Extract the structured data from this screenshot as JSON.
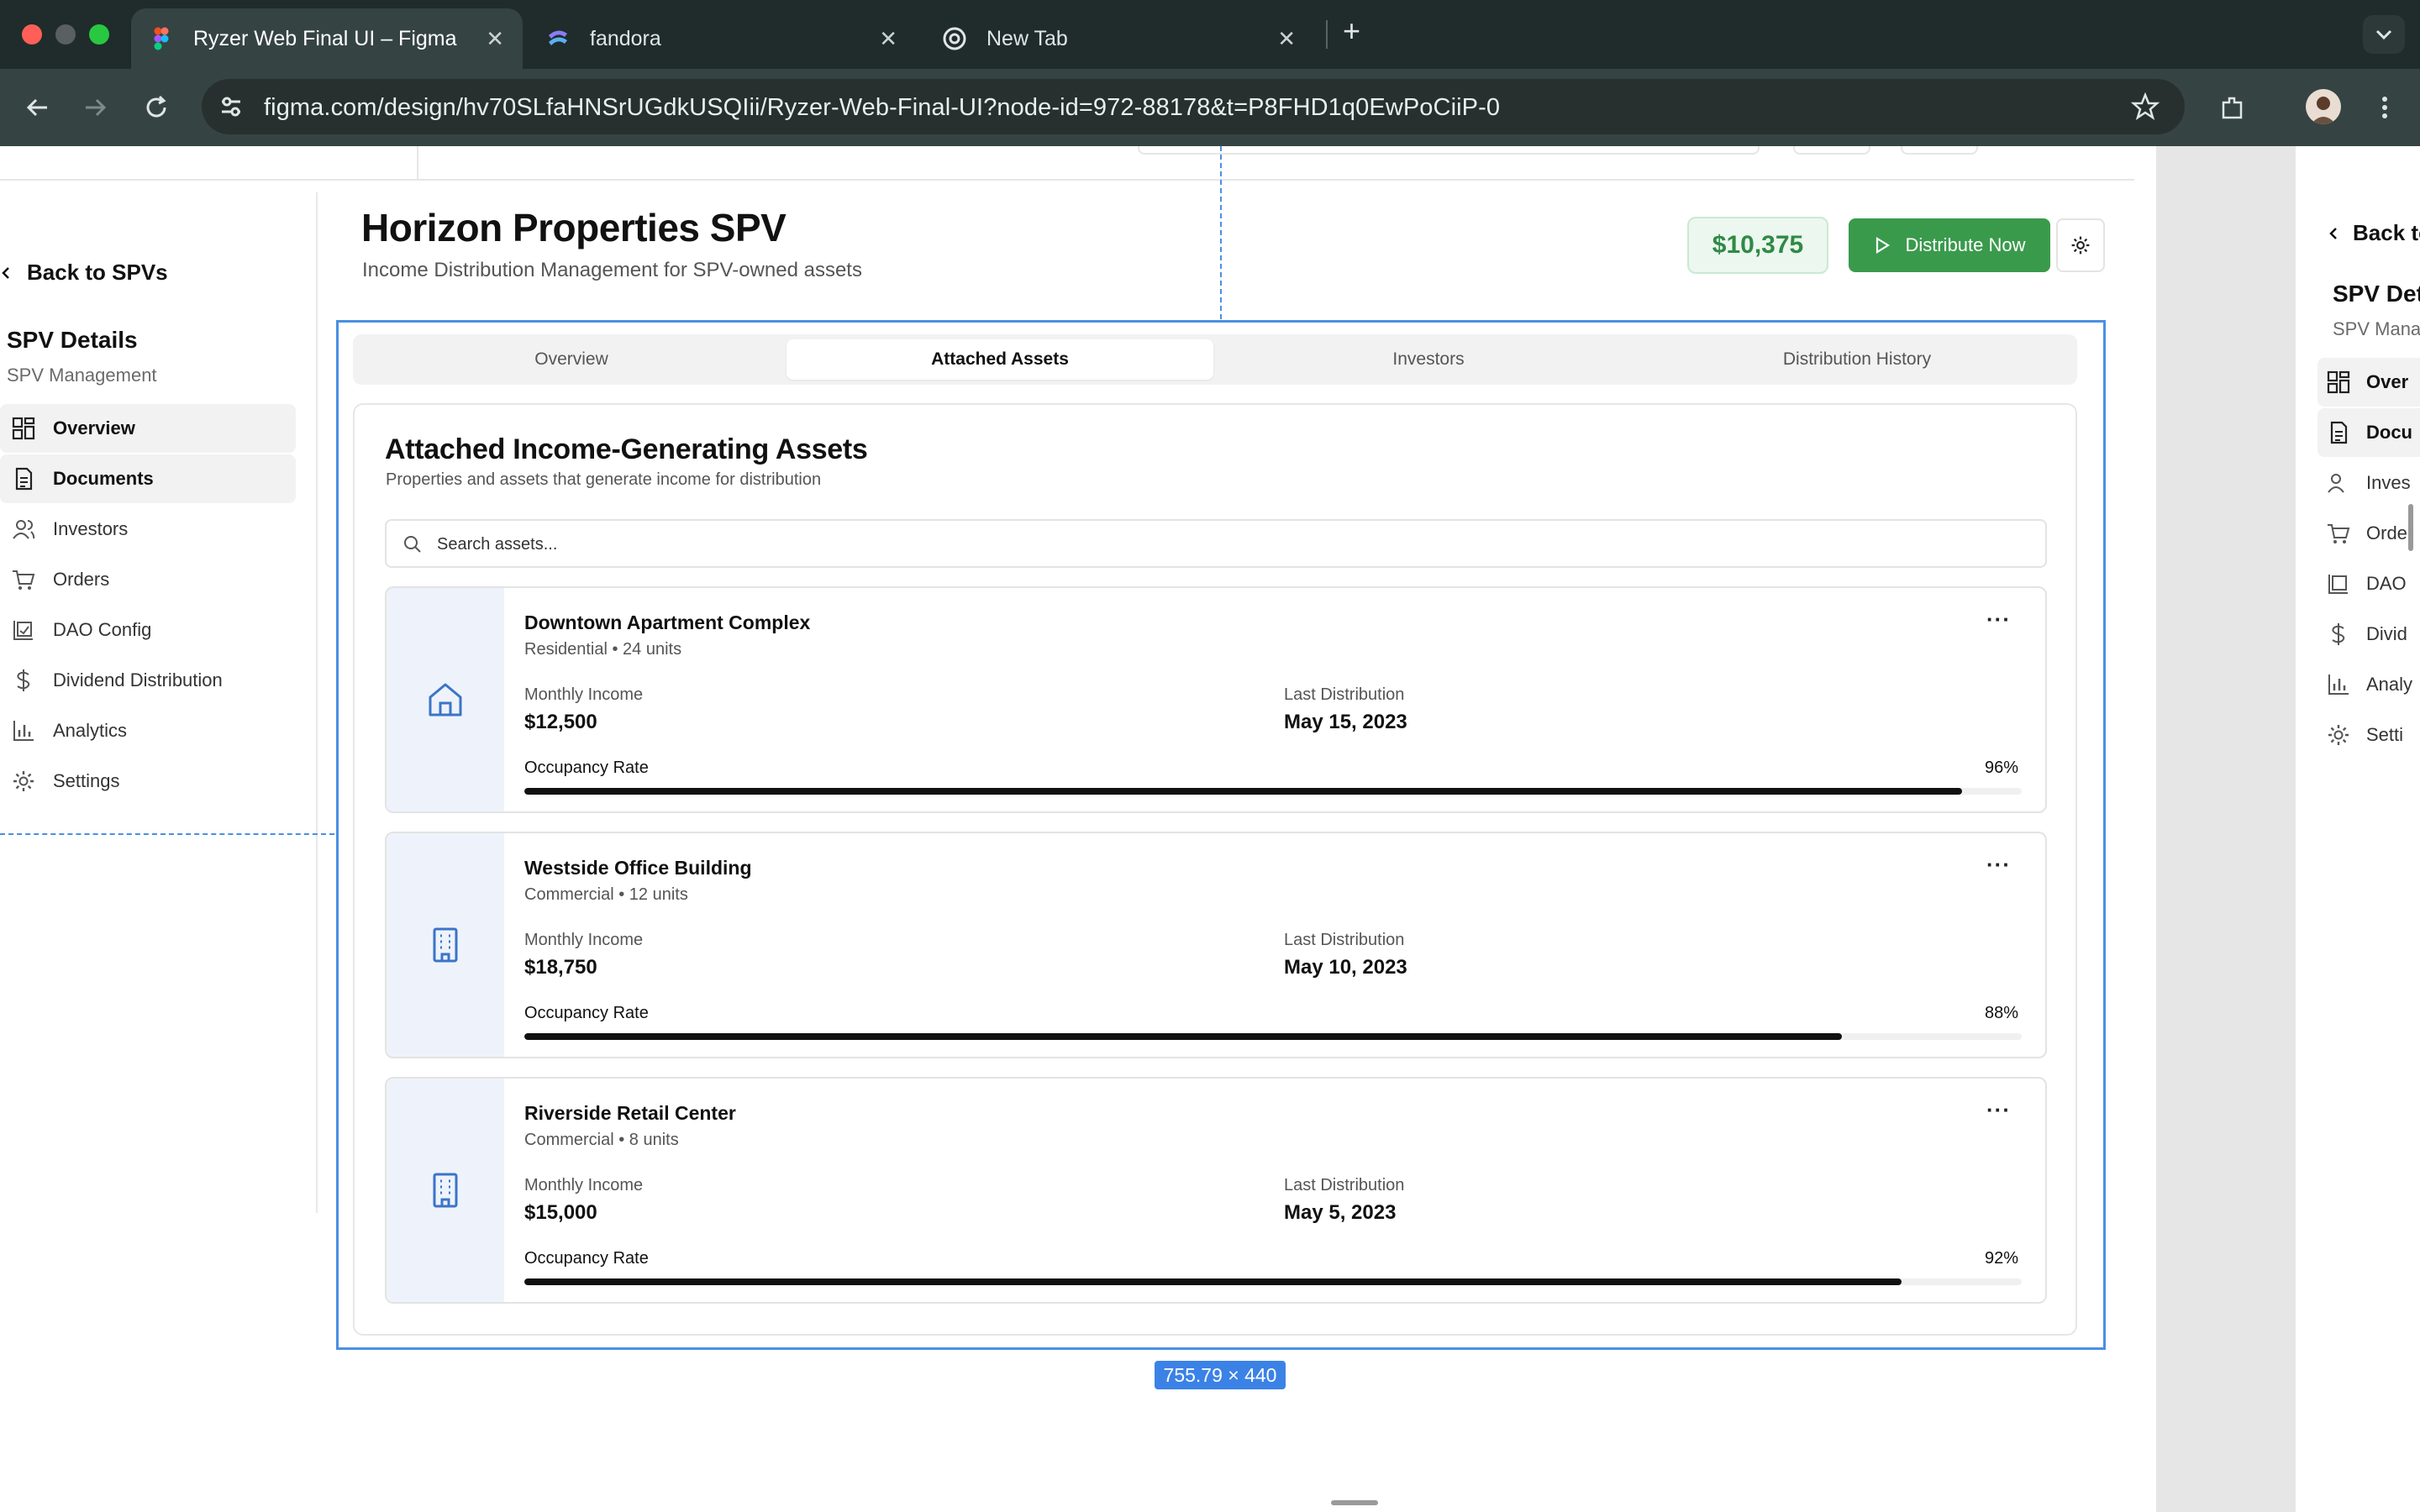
{
  "browser": {
    "tabs": [
      {
        "label": "Ryzer Web Final UI – Figma",
        "icon": "figma-icon",
        "active": true
      },
      {
        "label": "fandora",
        "icon": "fandora-icon",
        "active": false
      },
      {
        "label": "New Tab",
        "icon": "chrome-icon",
        "active": false
      }
    ],
    "close_glyph": "✕",
    "new_tab_glyph": "+",
    "url": "figma.com/design/hv70SLfaHNSrUGdkUSQIii/Ryzer-Web-Final-UI?node-id=972-88178&t=P8FHD1q0EwPoCiiP-0"
  },
  "sidebar": {
    "back_label": "Back to SPVs",
    "title": "SPV Details",
    "subtitle": "SPV Management",
    "items": [
      {
        "label": "Overview",
        "icon": "grid-icon",
        "active": false
      },
      {
        "label": "Documents",
        "icon": "document-icon",
        "active": true
      },
      {
        "label": "Investors",
        "icon": "users-icon",
        "active": false
      },
      {
        "label": "Orders",
        "icon": "cart-icon",
        "active": false
      },
      {
        "label": "DAO Config",
        "icon": "chart-check-icon",
        "active": false
      },
      {
        "label": "Dividend Distribution",
        "icon": "dollar-icon",
        "active": false
      },
      {
        "label": "Analytics",
        "icon": "bar-chart-icon",
        "active": false
      },
      {
        "label": "Settings",
        "icon": "gear-icon",
        "active": false
      }
    ]
  },
  "header": {
    "title": "Horizon Properties SPV",
    "subtitle": "Income Distribution Management for SPV-owned assets",
    "amount": "$10,375",
    "distribute_label": "Distribute Now"
  },
  "tabs": [
    {
      "label": "Overview",
      "active": false
    },
    {
      "label": "Attached Assets",
      "active": true
    },
    {
      "label": "Investors",
      "active": false
    },
    {
      "label": "Distribution History",
      "active": false
    }
  ],
  "assets_section": {
    "title": "Attached Income-Generating Assets",
    "subtitle": "Properties and assets that generate income for distribution",
    "search_placeholder": "Search assets...",
    "monthly_income_label": "Monthly Income",
    "last_distribution_label": "Last Distribution",
    "occupancy_label": "Occupancy Rate",
    "more_glyph": "···",
    "assets": [
      {
        "name": "Downtown Apartment Complex",
        "type": "Residential • 24 units",
        "monthly_income": "$12,500",
        "last_distribution": "May 15, 2023",
        "occupancy": "96%",
        "occupancy_value": 0.96,
        "icon": "house-icon"
      },
      {
        "name": "Westside Office Building",
        "type": "Commercial • 12 units",
        "monthly_income": "$18,750",
        "last_distribution": "May 10, 2023",
        "occupancy": "88%",
        "occupancy_value": 0.88,
        "icon": "building-icon"
      },
      {
        "name": "Riverside Retail Center",
        "type": "Commercial • 8 units",
        "monthly_income": "$15,000",
        "last_distribution": "May 5, 2023",
        "occupancy": "92%",
        "occupancy_value": 0.92,
        "icon": "building-icon"
      }
    ]
  },
  "figma": {
    "dimension_label": "755.79 × 440"
  },
  "right_frame": {
    "back_label": "Back to",
    "title": "SPV Det",
    "subtitle": "SPV Mana",
    "items": [
      "Over",
      "Docu",
      "Inves",
      "Orde",
      "DAO",
      "Divid",
      "Analy",
      "Setti"
    ]
  },
  "colors": {
    "accent_green": "#3a9a4c",
    "amount_green": "#2f8a45",
    "selection_blue": "#4a90e2",
    "asset_icon_blue": "#3b74c9"
  }
}
